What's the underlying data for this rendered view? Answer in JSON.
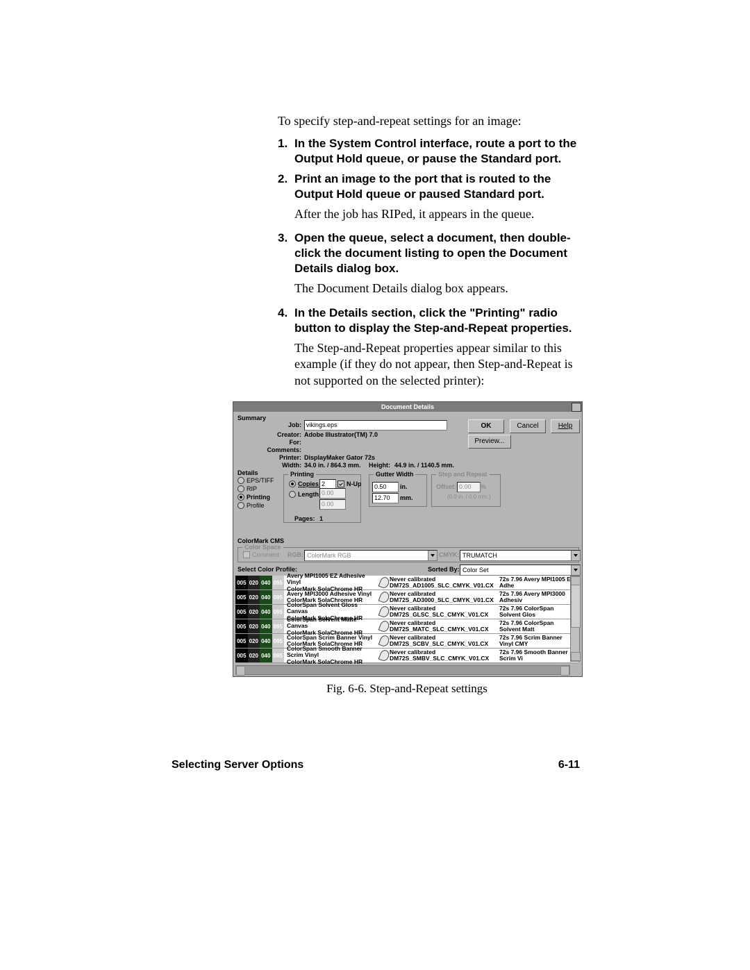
{
  "intro": "To specify step-and-repeat settings for an image:",
  "steps": [
    {
      "n": "1.",
      "bold": "In the System Control interface, route a port to the Output Hold queue, or pause the Standard port.",
      "after": null
    },
    {
      "n": "2.",
      "bold": "Print an image to the port that is routed to the Output Hold queue or paused Standard port.",
      "after": "After the job has RIPed, it appears in the queue."
    },
    {
      "n": "3.",
      "bold": "Open the queue, select a document, then double-click the document listing to open the Document Details dialog box.",
      "after": "The Document Details dialog box appears."
    },
    {
      "n": "4.",
      "bold": "In the Details section, click the \"Printing\" radio button to display the Step-and-Repeat properties.",
      "after": "The Step-and-Repeat properties appear similar to this example (if they do not appear, then Step-and-Repeat is not supported on the selected printer):"
    }
  ],
  "dialog": {
    "title": "Document Details",
    "buttons": {
      "ok": "OK",
      "cancel": "Cancel",
      "help": "Help",
      "preview": "Preview..."
    },
    "summary": {
      "label": "Summary",
      "fields": {
        "job_label": "Job:",
        "job_value": "vikings.eps",
        "creator_label": "Creator:",
        "creator_value": "Adobe Illustrator(TM) 7.0",
        "for_label": "For:",
        "for_value": "",
        "comments_label": "Comments:",
        "comments_value": "",
        "printer_label": "Printer:",
        "printer_value": "DisplayMaker Gator 72s",
        "width_label": "Width:",
        "width_value": "34.0 in. / 864.3 mm.",
        "height_label": "Height:",
        "height_value": "44.9 in. / 1140.5 mm."
      }
    },
    "details": {
      "label": "Details",
      "radios": {
        "eps": "EPS/TIFF",
        "rip": "RIP",
        "printing": "Printing",
        "profile": "Profile"
      }
    },
    "printing": {
      "label": "Printing",
      "copies_label": "Copies:",
      "copies_value": "2",
      "nup_label": "N-Up",
      "length_label": "Length:",
      "length_in": "0.00",
      "length_mm": "0.00",
      "pages_label": "Pages:",
      "pages_value": "1"
    },
    "gutter": {
      "label": "Gutter Width",
      "in_value": "0.50",
      "in_label": "in.",
      "mm_value": "12.70",
      "mm_label": "mm."
    },
    "steprepeat": {
      "label": "Step and Repeat",
      "offset_label": "Offset:",
      "offset_value": "0.00",
      "offset_unit": "%",
      "note": "(0.0 in. / 0.0 mm.)"
    },
    "cms": {
      "label": "ColorMark CMS",
      "colorspace_label": "Color Space",
      "comment_label": "Comment",
      "rgb_label": "RGB:",
      "rgb_value": "ColorMark RGB",
      "cmyk_label": "CMYK:",
      "cmyk_value": "TRUMATCH",
      "select_profile_label": "Select Color Profile:",
      "sorted_by_label": "Sorted By:",
      "sorted_by_value": "Color Set"
    },
    "swatch": {
      "a": "005",
      "b": "020",
      "c": "040",
      "d": "095"
    },
    "profiles": [
      {
        "name": "Avery MPI1005 EZ Adhesive Vinyl",
        "sub": "ColorMark SolaChrome HR",
        "cal": "Never calibrated",
        "file": "DM72S_AD1005_SLC_CMYK_V01.CX",
        "set": "72s 7.96 Avery MPI1005 EZ Adhe"
      },
      {
        "name": "Avery MPI3000 Adhesive Vinyl",
        "sub": "ColorMark SolaChrome HR",
        "cal": "Never calibrated",
        "file": "DM72S_AD3000_SLC_CMYK_V01.CX",
        "set": "72s 7.96 Avery MPI3000 Adhesiv"
      },
      {
        "name": "ColorSpan Solvent Gloss Canvas",
        "sub": "ColorMark SolaChrome HR",
        "cal": "Never calibrated",
        "file": "DM72S_GLSC_SLC_CMYK_V01.CX",
        "set": "72s 7.96 ColorSpan Solvent Glos"
      },
      {
        "name": "ColorSpan Solvent Matte Canvas",
        "sub": "ColorMark SolaChrome HR",
        "cal": "Never calibrated",
        "file": "DM72S_MATC_SLC_CMYK_V01.CX",
        "set": "72s 7.96 ColorSpan Solvent Matt"
      },
      {
        "name": "ColorSpan Scrim Banner Vinyl",
        "sub": "ColorMark SolaChrome HR",
        "cal": "Never calibrated",
        "file": "DM72S_SCBV_SLC_CMYK_V01.CX",
        "set": "72s 7.96 Scrim Banner Vinyl CMY"
      },
      {
        "name": "ColorSpan Smooth Banner Scrim Vinyl",
        "sub": "ColorMark SolaChrome HR",
        "cal": "Never calibrated",
        "file": "DM72S_SMBV_SLC_CMYK_V01.CX",
        "set": "72s 7.96 Smooth Banner Scrim Vi"
      }
    ]
  },
  "caption": "Fig. 6-6. Step-and-Repeat settings",
  "footer": {
    "left": "Selecting Server Options",
    "right": "6-11"
  }
}
